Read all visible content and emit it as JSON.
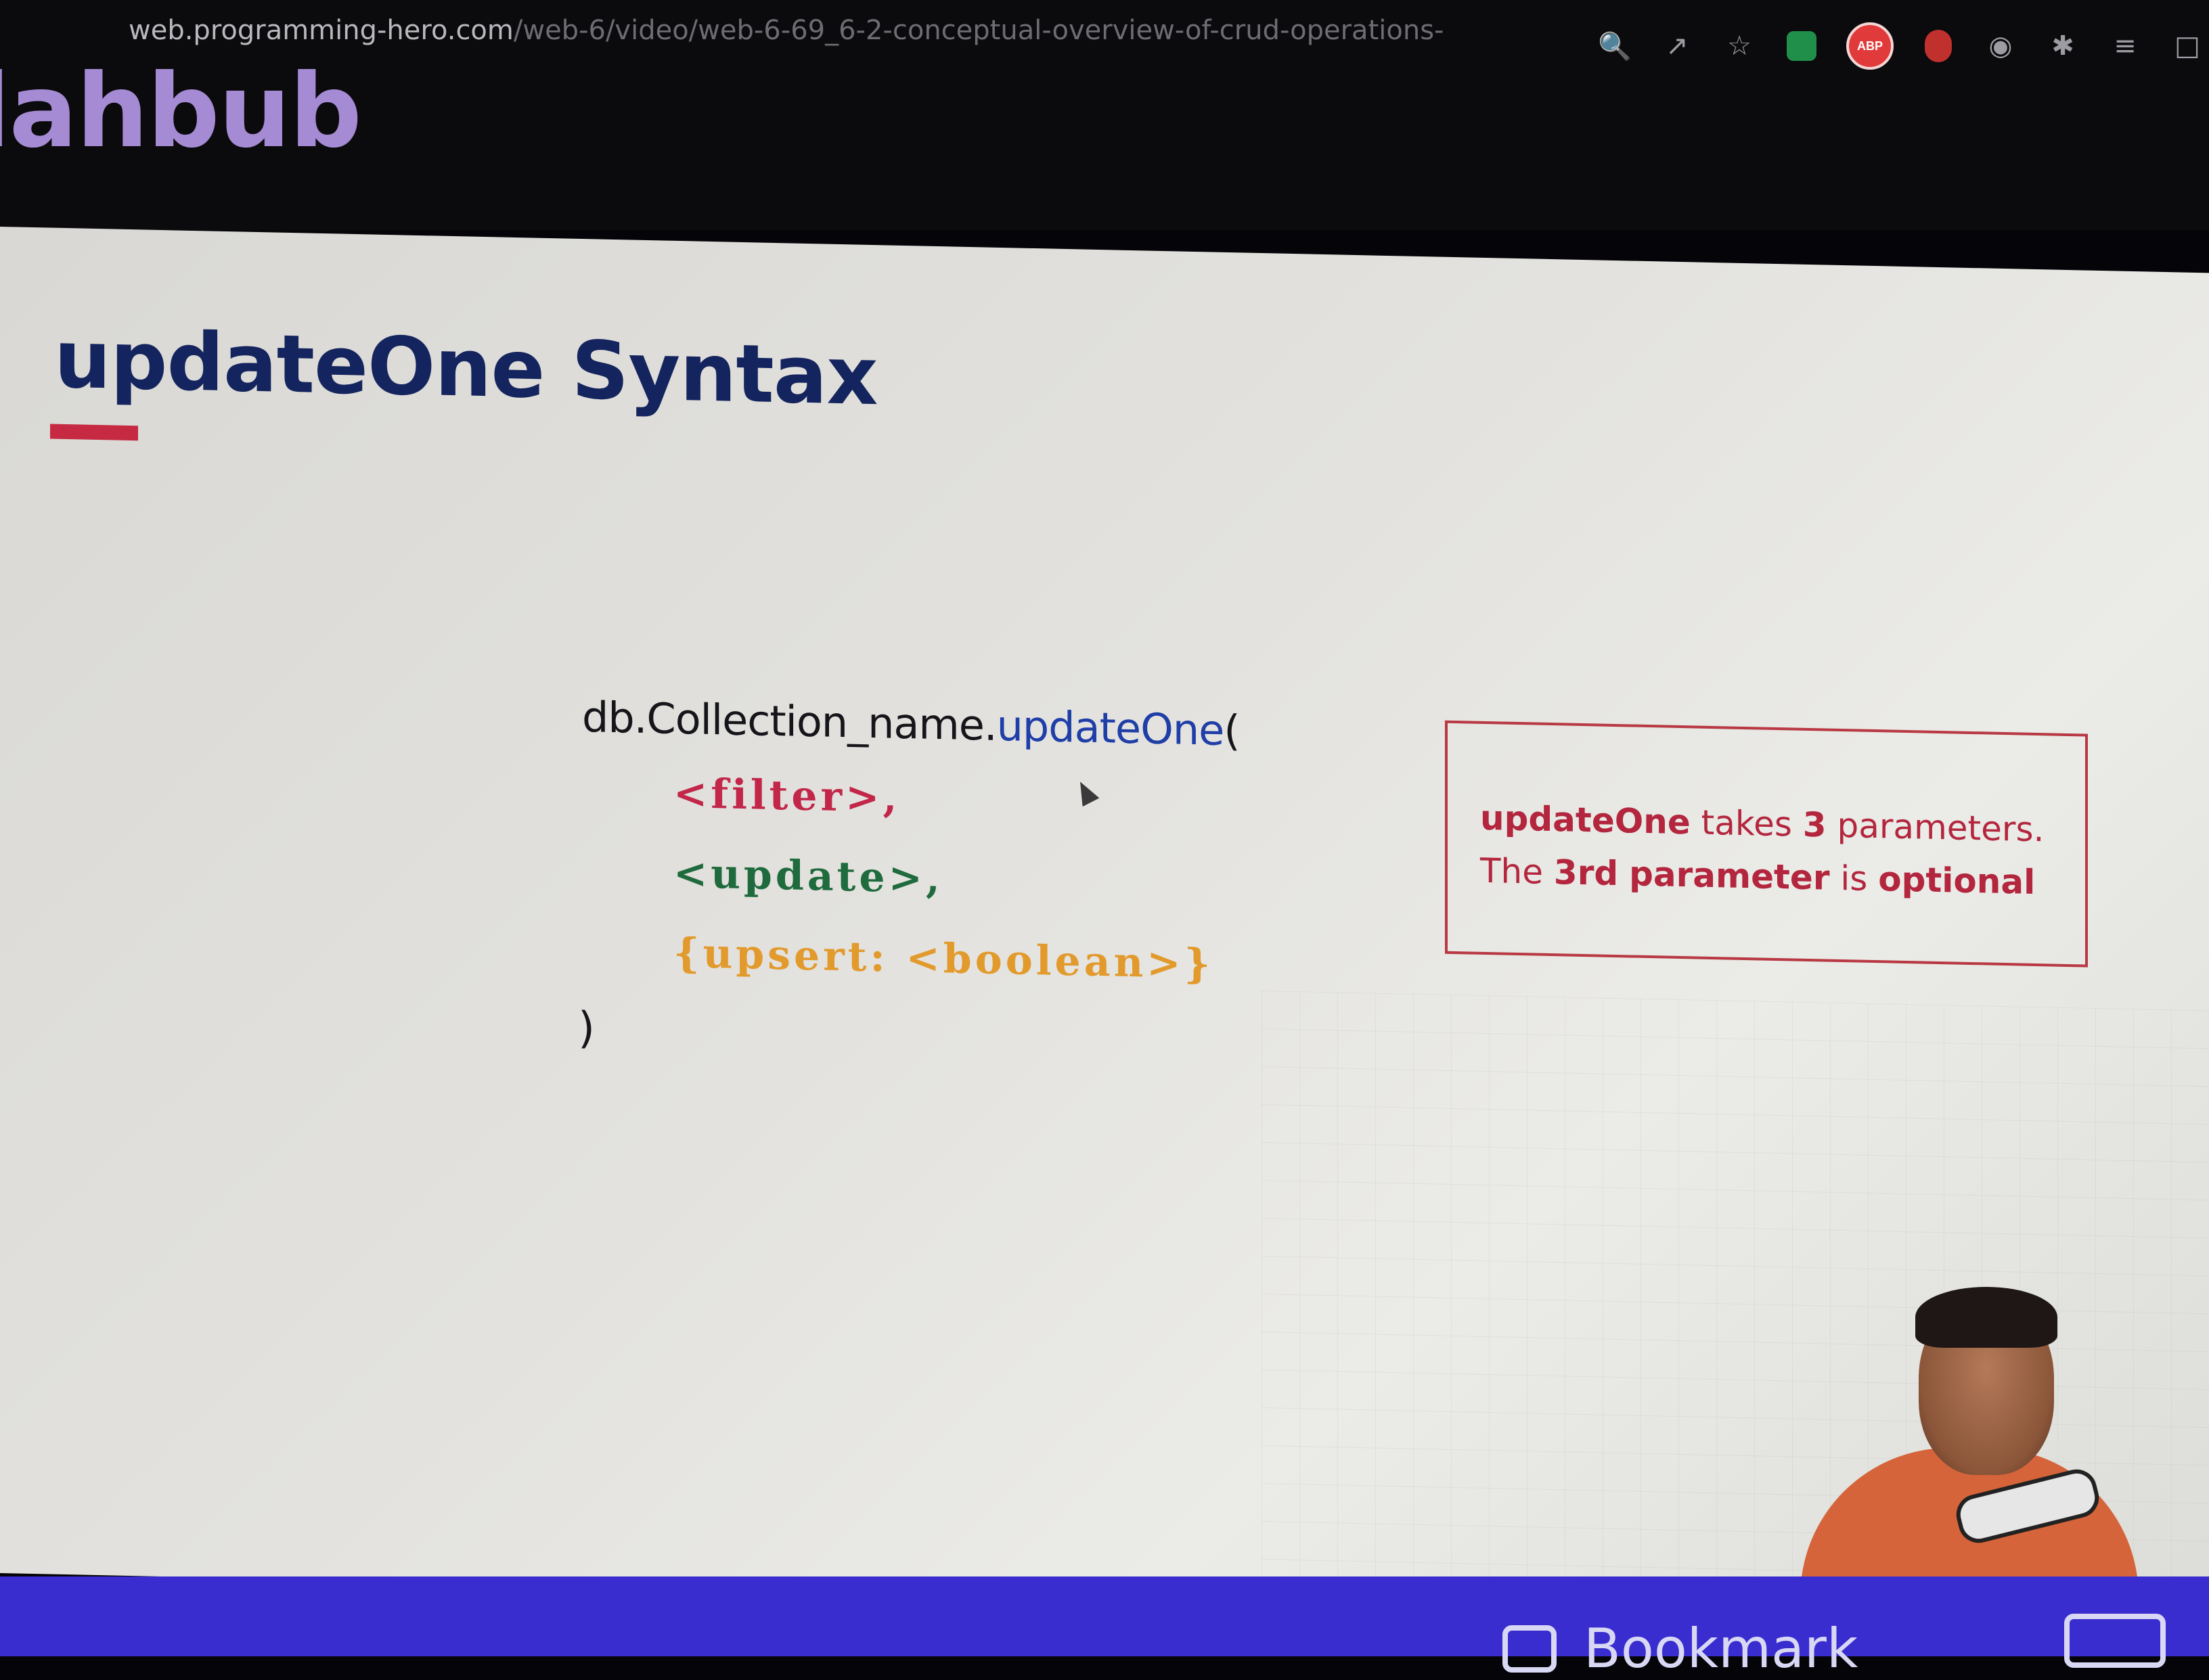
{
  "browser": {
    "url_domain": "web.programming-hero.com",
    "url_path": "/web-6/video/web-6-69_6-2-conceptual-overview-of-crud-operations-",
    "toolbar_icons": [
      "zoom-icon",
      "share-icon",
      "star-icon",
      "extension-green-icon",
      "adblock-icon",
      "extension-red-icon",
      "extension-circle-icon",
      "puzzle-icon",
      "reading-list-icon",
      "window-icon"
    ],
    "adblock_label": "ABP"
  },
  "site": {
    "brand_partial": "lahbub"
  },
  "slide": {
    "title": "updateOne Syntax",
    "code": {
      "prefix": "db.Collection_name.",
      "method": "updateOne",
      "open_paren": "(",
      "param_filter": "<filter>,",
      "param_update": "<update>,",
      "param_upsert": "{upsert: <boolean>}",
      "close_paren": ")"
    },
    "note": {
      "method": "updateOne",
      "takes": "takes",
      "count": "3",
      "parameters": "parameters.",
      "the": "The",
      "third": "3rd",
      "parameter": "parameter",
      "is": "is",
      "optional": "optional"
    }
  },
  "bottom_bar": {
    "bookmark_label": "Bookmark"
  },
  "colors": {
    "title": "#14245e",
    "accent_red": "#c62a42",
    "filter": "#c2274a",
    "update": "#1f6b3d",
    "upsert": "#e29a2c",
    "method_blue": "#1f3ea8",
    "bottom_bar": "#3a2dd0"
  }
}
